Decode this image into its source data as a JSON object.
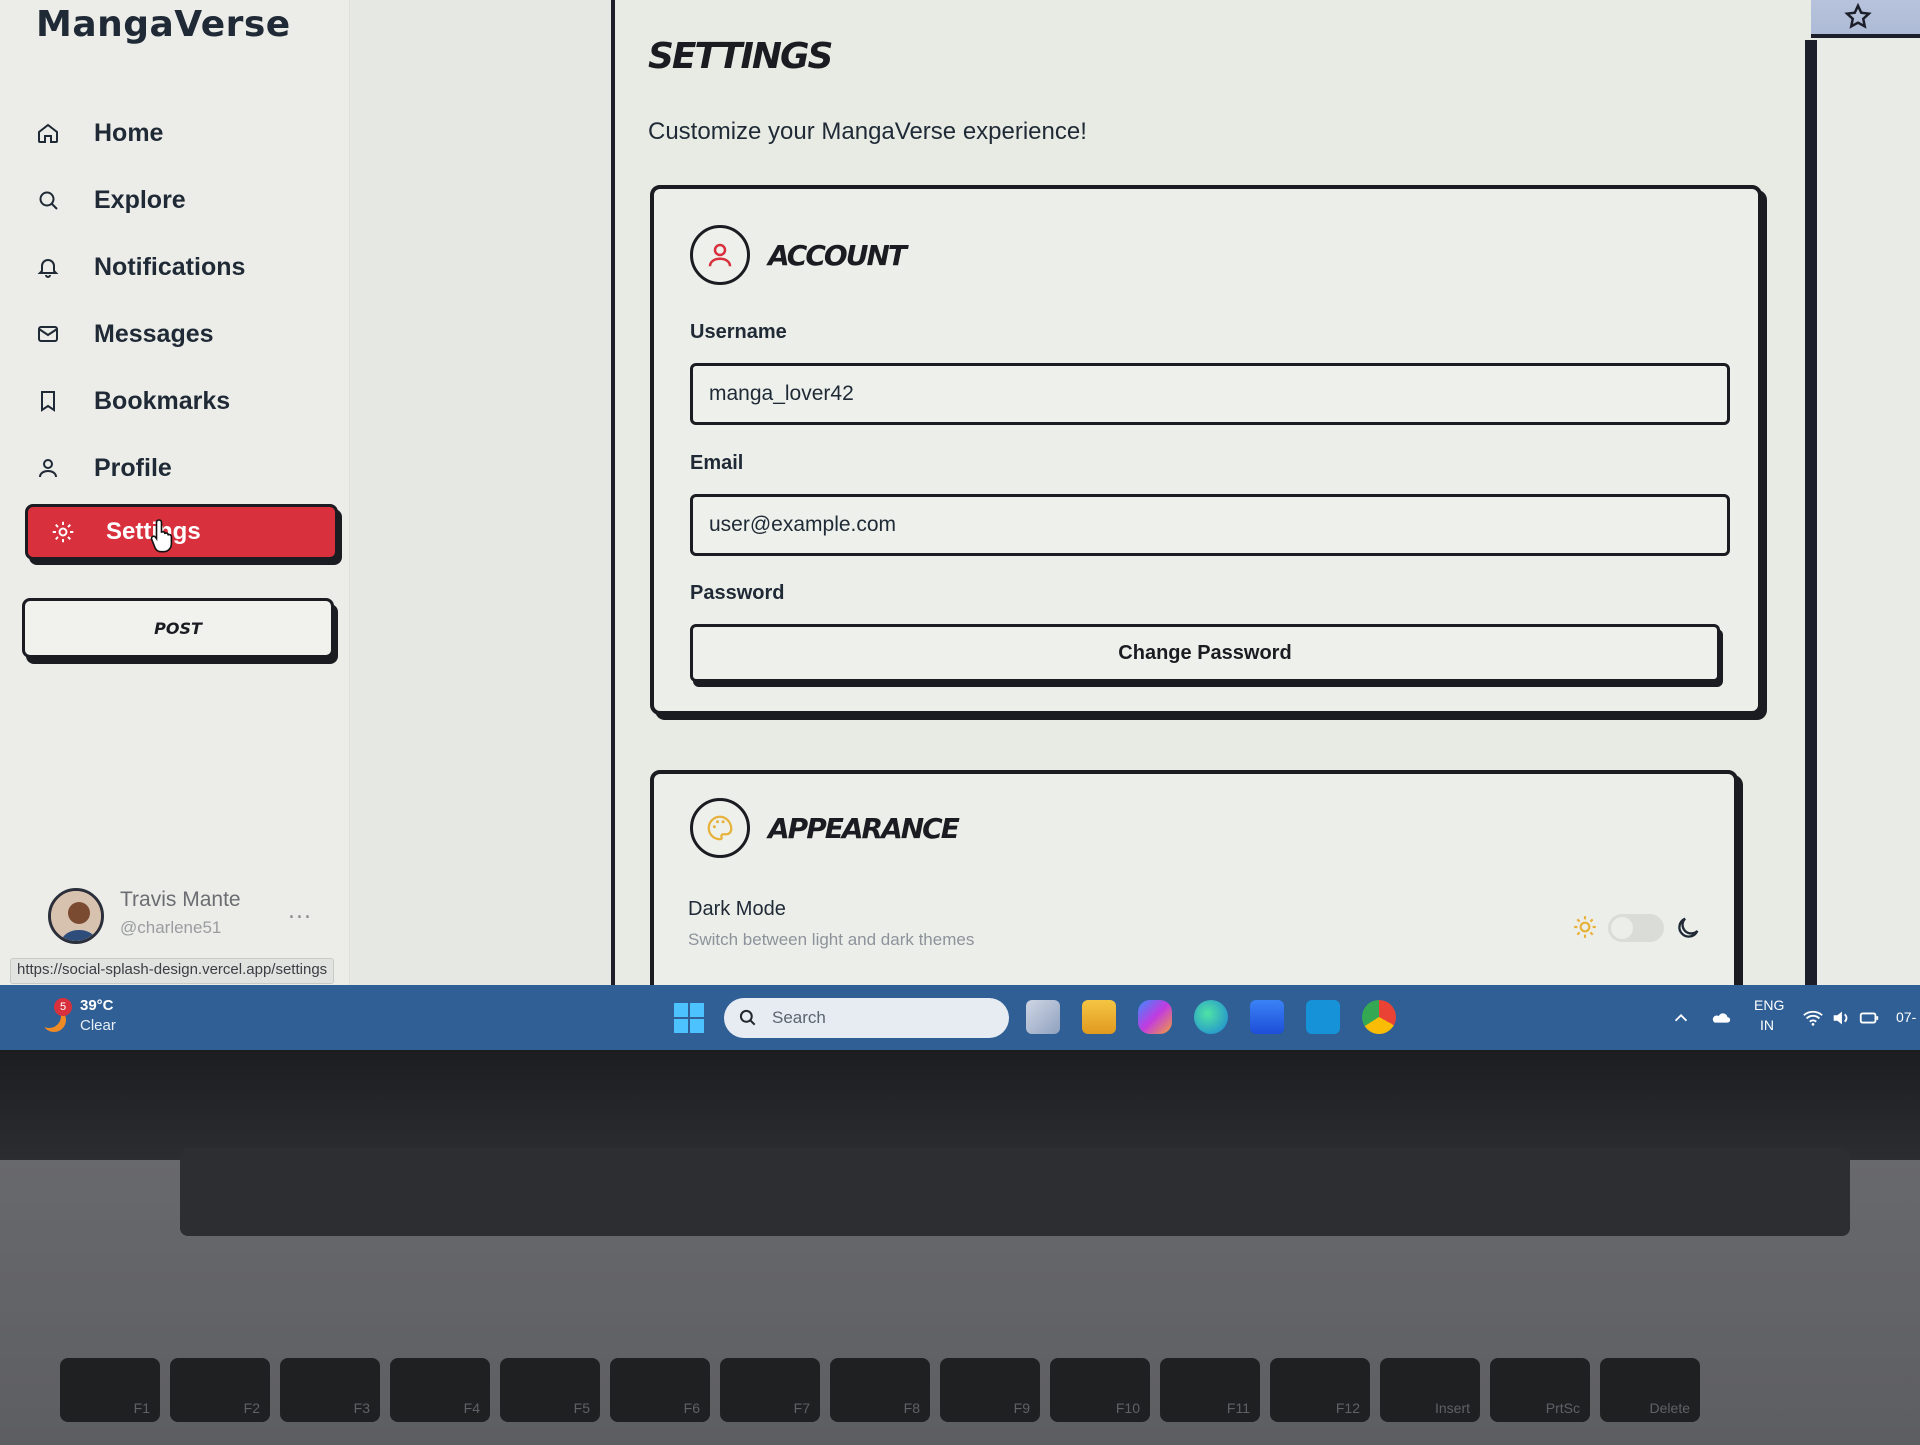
{
  "app": {
    "logo": "MangaVerse"
  },
  "sidebar": {
    "items": [
      {
        "label": "Home",
        "icon": "home-icon"
      },
      {
        "label": "Explore",
        "icon": "search-icon"
      },
      {
        "label": "Notifications",
        "icon": "bell-icon"
      },
      {
        "label": "Messages",
        "icon": "mail-icon"
      },
      {
        "label": "Bookmarks",
        "icon": "bookmark-icon"
      },
      {
        "label": "Profile",
        "icon": "user-icon"
      }
    ],
    "active_item": {
      "label": "Settings",
      "icon": "gear-icon"
    },
    "post_label": "POST",
    "user": {
      "name": "Travis Mante",
      "handle": "@charlene51",
      "more": "..."
    },
    "status_url": "https://social-splash-design.vercel.app/settings"
  },
  "main": {
    "title": "SETTINGS",
    "subtitle": "Customize your MangaVerse experience!",
    "account": {
      "title": "ACCOUNT",
      "username_label": "Username",
      "username_value": "manga_lover42",
      "email_label": "Email",
      "email_value": "user@example.com",
      "password_label": "Password",
      "change_password_label": "Change Password"
    },
    "appearance": {
      "title": "APPEARANCE",
      "dark_mode_label": "Dark Mode",
      "dark_mode_desc": "Switch between light and dark themes",
      "dark_mode_on": false
    }
  },
  "taskbar": {
    "weather": {
      "badge": "5",
      "temp": "39°C",
      "condition": "Clear"
    },
    "search_placeholder": "Search",
    "lang_top": "ENG",
    "lang_bottom": "IN",
    "clock_partial": "07-"
  },
  "keyboard": {
    "keys": [
      "F1",
      "F2",
      "F3",
      "F4",
      "F5",
      "F6",
      "F7",
      "F8",
      "F9",
      "F10",
      "F11",
      "F12",
      "Insert",
      "PrtSc",
      "Delete"
    ]
  },
  "colors": {
    "accent": "#d8313d",
    "ink": "#1a1c22",
    "taskbar": "#2f5f95",
    "background": "#e9ebe6"
  }
}
